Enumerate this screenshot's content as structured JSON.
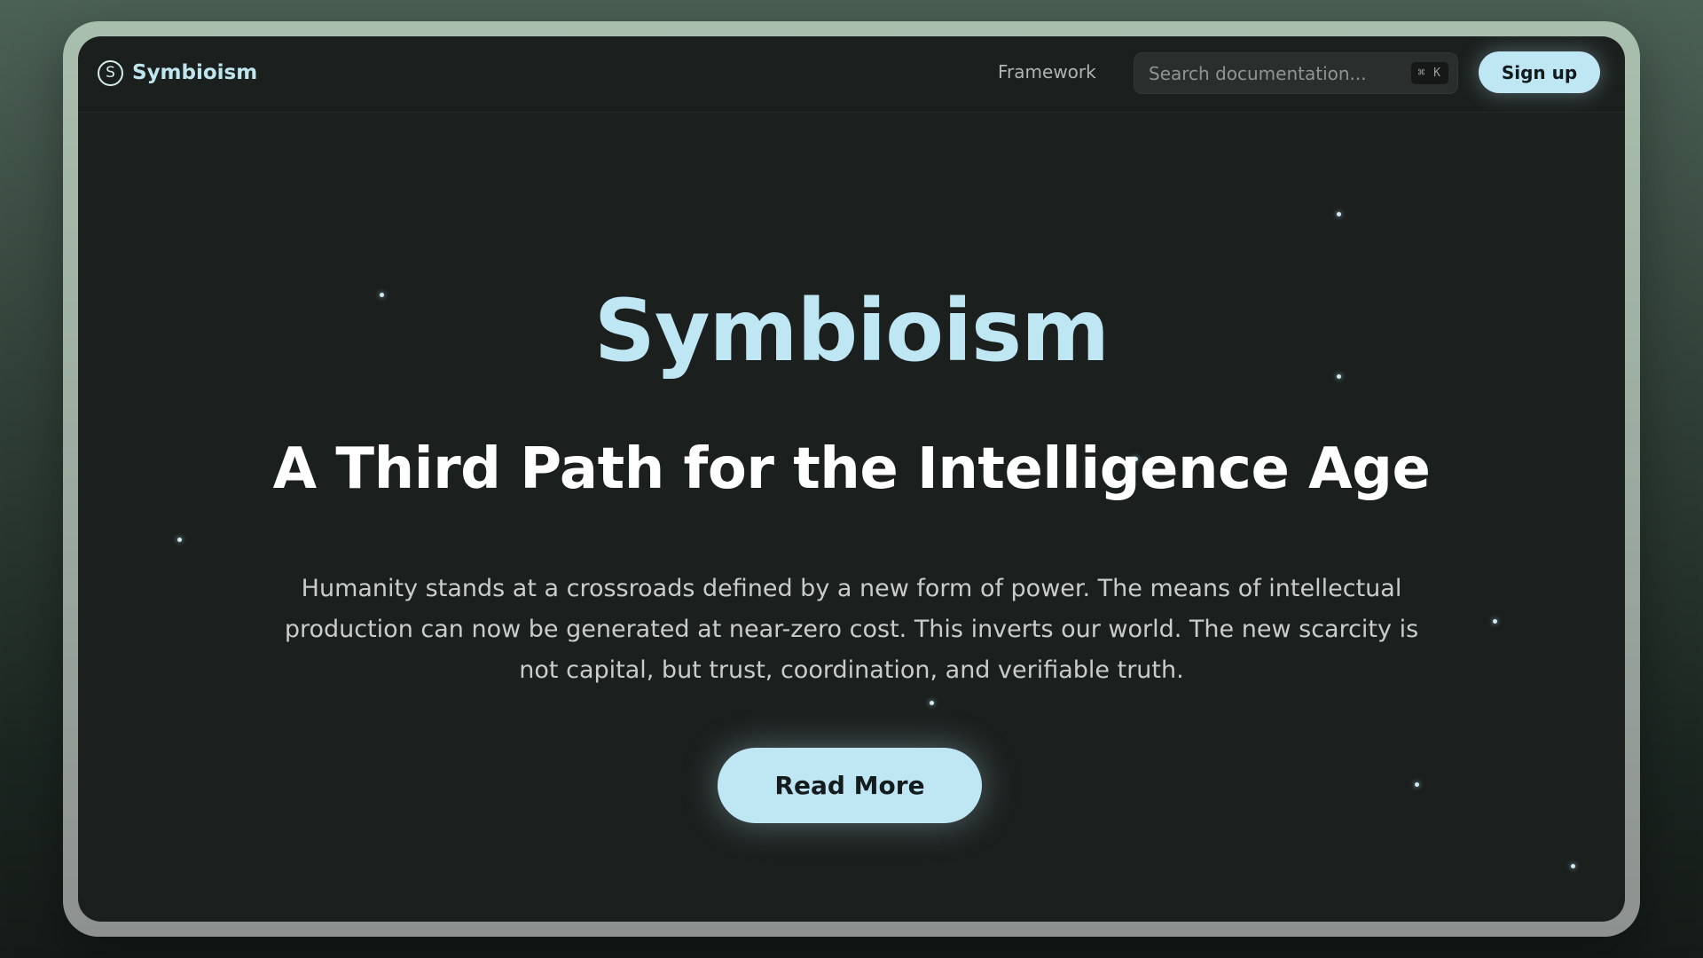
{
  "nav": {
    "brand": "Symbioism",
    "brand_icon": "S",
    "links": [
      {
        "label": "Framework"
      }
    ],
    "search_placeholder": "Search documentation...",
    "search_shortcut": "⌘ K",
    "signup_label": "Sign up"
  },
  "hero": {
    "title": "Symbioism",
    "subtitle": "A Third Path for the Intelligence Age",
    "body": "Humanity stands at a crossroads defined by a new form of power. The means of intellectual production can now be generated at near-zero cost. This inverts our world. The new scarcity is not capital, but trust, coordination, and verifiable truth.",
    "cta_label": "Read More"
  },
  "colors": {
    "accent": "#bfe6f3",
    "background": "#1b201e",
    "frame": "#a9bfae"
  }
}
